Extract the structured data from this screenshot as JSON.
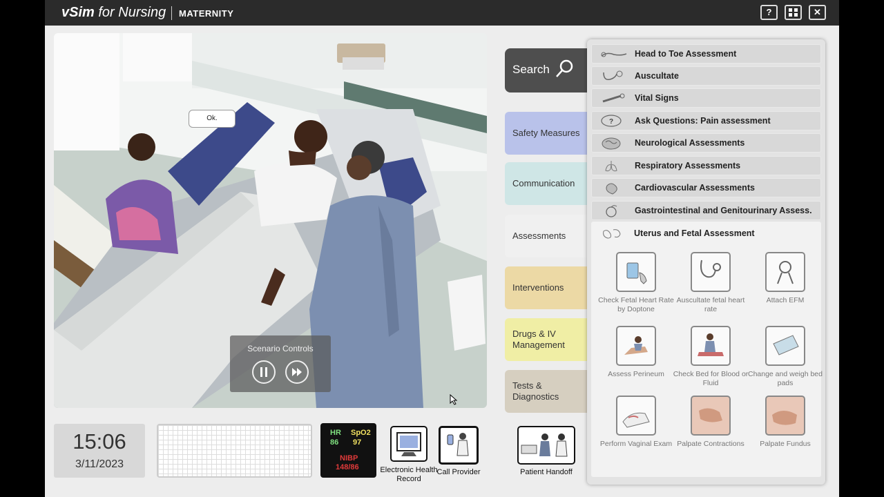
{
  "header": {
    "brand_main": "vSim",
    "brand_for": "for Nursing",
    "product": "MATERNITY",
    "help_label": "?",
    "close_label": "✕"
  },
  "scene": {
    "speech_bubble": "Ok.",
    "scenario_controls_title": "Scenario Controls"
  },
  "search": {
    "label": "Search"
  },
  "categories": [
    {
      "label": "Safety Measures",
      "color": "#b9c2ea"
    },
    {
      "label": "Communication",
      "color": "#cfe6e6"
    },
    {
      "label": "Assessments",
      "color": "#f0f0f0"
    },
    {
      "label": "Interventions",
      "color": "#ecd9a5"
    },
    {
      "label": "Drugs & IV Management",
      "color": "#f0eea5"
    },
    {
      "label": "Tests & Diagnostics",
      "color": "#d6cfc0"
    }
  ],
  "assessment_menu": [
    {
      "label": "Head to Toe Assessment",
      "icon": "body-icon"
    },
    {
      "label": "Auscultate",
      "icon": "stethoscope-icon"
    },
    {
      "label": "Vital Signs",
      "icon": "thermometer-icon"
    },
    {
      "label": "Ask Questions: Pain assessment",
      "icon": "speech-question-icon"
    },
    {
      "label": "Neurological Assessments",
      "icon": "brain-icon"
    },
    {
      "label": "Respiratory Assessments",
      "icon": "lungs-icon"
    },
    {
      "label": "Cardiovascular Assessments",
      "icon": "heart-icon"
    },
    {
      "label": "Gastrointestinal and Genitourinary Assess.",
      "icon": "stomach-icon"
    }
  ],
  "uterus_section": {
    "title": "Uterus and Fetal Assessment",
    "actions": [
      {
        "label": "Check Fetal Heart Rate by Doptone",
        "icon": "doptone-icon"
      },
      {
        "label": "Auscultate fetal heart rate",
        "icon": "stethoscope-icon"
      },
      {
        "label": "Attach EFM",
        "icon": "efm-icon"
      },
      {
        "label": "Assess Perineum",
        "icon": "perineum-icon"
      },
      {
        "label": "Check Bed for Blood or Fluid",
        "icon": "bed-check-icon"
      },
      {
        "label": "Change and weigh bed pads",
        "icon": "bed-pad-icon"
      },
      {
        "label": "Perform Vaginal Exam",
        "icon": "vaginal-exam-icon"
      },
      {
        "label": "Palpate Contractions",
        "icon": "palpate-contractions-icon"
      },
      {
        "label": "Palpate Fundus",
        "icon": "palpate-fundus-icon"
      }
    ]
  },
  "clock": {
    "time": "15:06",
    "date": "3/11/2023"
  },
  "vitals": {
    "hr_label": "HR",
    "hr_value": "86",
    "spo2_label": "SpO2",
    "spo2_value": "97",
    "nibp_label": "NIBP",
    "nibp_value": "148/86",
    "green": "#7fe07f",
    "yellow": "#f0e060",
    "red": "#e03a3a"
  },
  "tools": {
    "ehr_label": "Electronic Health Record",
    "call_provider_label": "Call Provider",
    "handoff_label": "Patient Handoff"
  }
}
